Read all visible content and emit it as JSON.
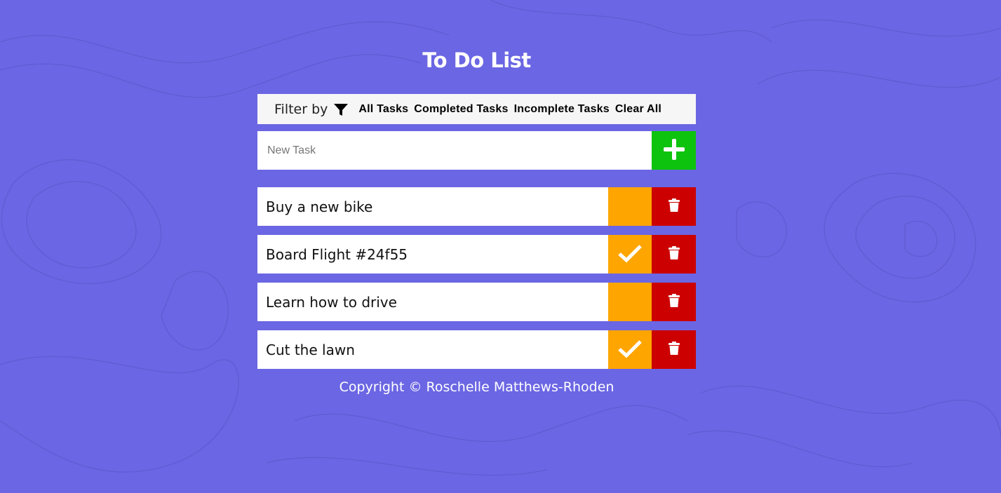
{
  "header": {
    "title": "To Do List"
  },
  "filter": {
    "label": "Filter by",
    "icon": "funnel-icon",
    "options": [
      "All Tasks",
      "Completed Tasks",
      "Incomplete Tasks",
      "Clear All"
    ]
  },
  "new_task": {
    "placeholder": "New Task",
    "value": "",
    "add_icon": "plus-icon"
  },
  "tasks": [
    {
      "text": "Buy a new bike",
      "completed": false
    },
    {
      "text": "Board Flight #24f55",
      "completed": true
    },
    {
      "text": "Learn how to drive",
      "completed": false
    },
    {
      "text": "Cut the lawn",
      "completed": true
    }
  ],
  "footer": {
    "text": "Copyright © Roschelle Matthews-Rhoden"
  },
  "colors": {
    "background": "#6b66e3",
    "add": "#0ec30e",
    "complete": "#ffa500",
    "delete": "#cc0000"
  }
}
